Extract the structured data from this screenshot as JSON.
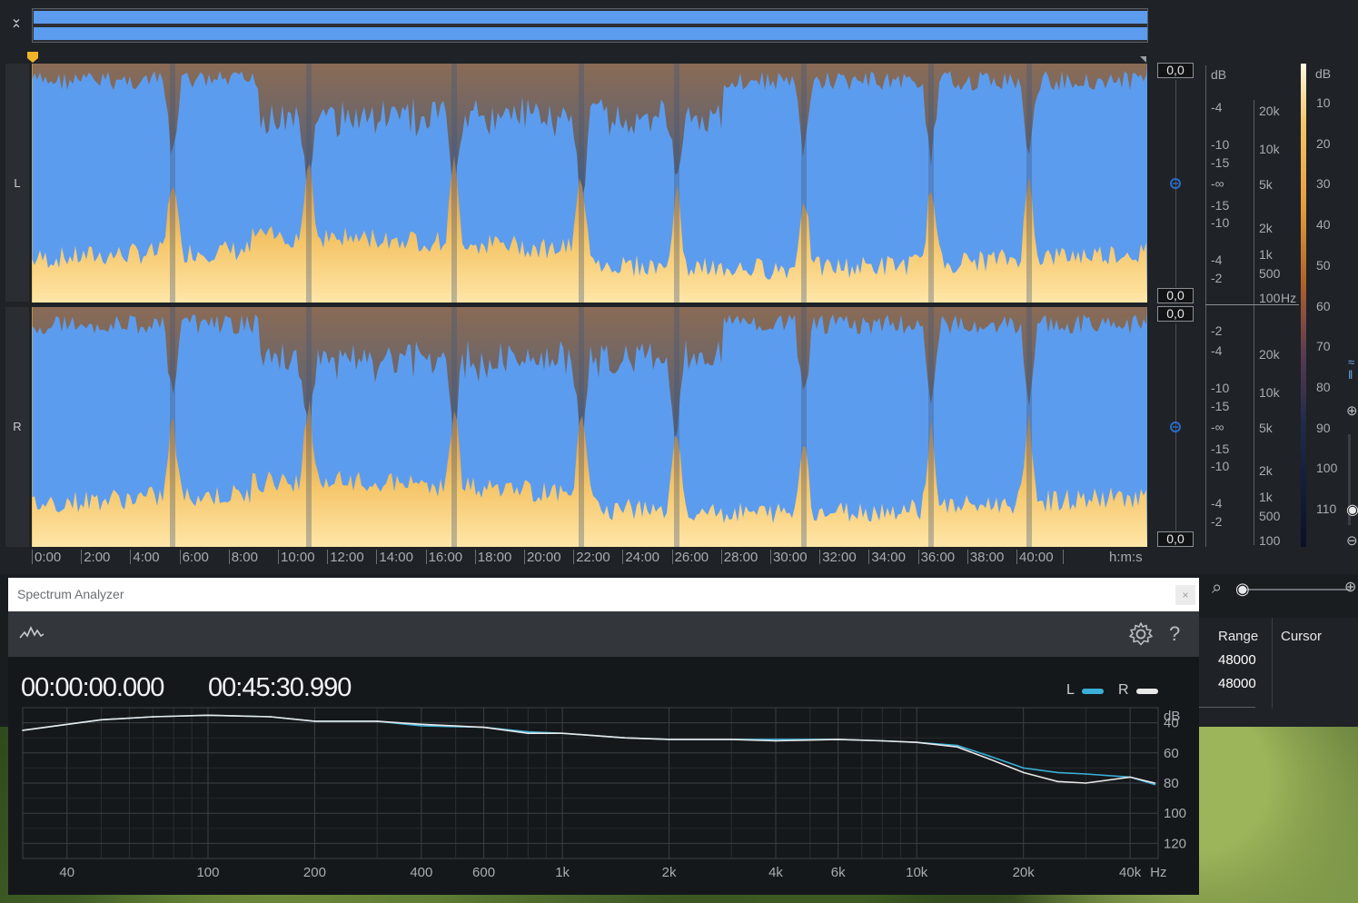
{
  "editor": {
    "channels": [
      {
        "label": "L",
        "peak_top": "0,0",
        "peak_bottom": "0,0"
      },
      {
        "label": "R",
        "peak_top": "0,0",
        "peak_bottom": "0,0"
      }
    ],
    "time_axis": {
      "labels": [
        "0:00",
        "2:00",
        "4:00",
        "6:00",
        "8:00",
        "10:00",
        "12:00",
        "14:00",
        "16:00",
        "18:00",
        "20:00",
        "22:00",
        "24:00",
        "26:00",
        "28:00",
        "30:00",
        "32:00",
        "34:00",
        "36:00",
        "38:00",
        "40:00"
      ],
      "unit": "h:m:s"
    },
    "amp_scale_L": [
      "dB",
      "-4",
      "-10",
      "-15",
      "-∞",
      "-15",
      "-10",
      "-4",
      "-2"
    ],
    "amp_scale_R": [
      "-2",
      "-4",
      "-10",
      "-15",
      "-∞",
      "-15",
      "-10",
      "-4",
      "-2"
    ],
    "freq_scale_L": [
      "20k",
      "10k",
      "5k",
      "2k",
      "1k",
      "500",
      "100"
    ],
    "freq_scale_R": [
      "20k",
      "10k",
      "5k",
      "2k",
      "1k",
      "500",
      "100"
    ],
    "freq_unit": "Hz",
    "colorbar": {
      "unit": "dB",
      "labels": [
        "10",
        "20",
        "30",
        "40",
        "50",
        "60",
        "70",
        "80",
        "90",
        "100",
        "110"
      ]
    },
    "colors": {
      "waveform": "#5c9cee",
      "spectro_hot": "#f5c66a",
      "spectro_mid": "#c9873f"
    }
  },
  "info_panel": {
    "headers": [
      "Range",
      "Cursor"
    ],
    "rows": [
      "48000",
      "48000"
    ]
  },
  "spectrum_analyzer": {
    "title": "Spectrum Analyzer",
    "close_label": "×",
    "help_label": "?",
    "start_time": "00:00:00.000",
    "end_time": "00:45:30.990",
    "legend": [
      {
        "name": "L",
        "color": "#3ab0d8"
      },
      {
        "name": "R",
        "color": "#e8e8e8"
      }
    ],
    "chart_data": {
      "type": "line",
      "xlabel": "Hz",
      "ylabel": "dB",
      "x_ticks": [
        "40",
        "100",
        "200",
        "400",
        "600",
        "1k",
        "2k",
        "4k",
        "6k",
        "10k",
        "20k",
        "40k"
      ],
      "x_ticks_hz": [
        40,
        100,
        200,
        400,
        600,
        1000,
        2000,
        4000,
        6000,
        10000,
        20000,
        40000
      ],
      "y_ticks": [
        "40",
        "60",
        "80",
        "100",
        "120"
      ],
      "y_ticks_db": [
        40,
        60,
        80,
        100,
        120
      ],
      "xlim": [
        30,
        48000
      ],
      "ylim": [
        30,
        130
      ],
      "x_scale": "log",
      "grid": true,
      "legend_position": "top-right",
      "series": [
        {
          "name": "L",
          "x": [
            30,
            50,
            70,
            100,
            150,
            200,
            300,
            400,
            600,
            800,
            1000,
            1500,
            2000,
            3000,
            4000,
            6000,
            8000,
            10000,
            13000,
            16000,
            20000,
            25000,
            30000,
            40000,
            47000
          ],
          "y": [
            45,
            38,
            36,
            35,
            36,
            39,
            39,
            42,
            43,
            46,
            47,
            50,
            51,
            51,
            51,
            51,
            52,
            53,
            55,
            62,
            70,
            73,
            74,
            76,
            81
          ]
        },
        {
          "name": "R",
          "x": [
            30,
            50,
            70,
            100,
            150,
            200,
            300,
            400,
            600,
            800,
            1000,
            1500,
            2000,
            3000,
            4000,
            6000,
            8000,
            10000,
            13000,
            16000,
            20000,
            25000,
            30000,
            40000,
            47000
          ],
          "y": [
            45,
            38,
            36,
            35,
            36,
            39,
            39,
            41,
            43,
            47,
            47,
            50,
            51,
            51,
            52,
            51,
            52,
            53,
            56,
            64,
            73,
            79,
            80,
            76,
            80
          ]
        }
      ]
    }
  }
}
